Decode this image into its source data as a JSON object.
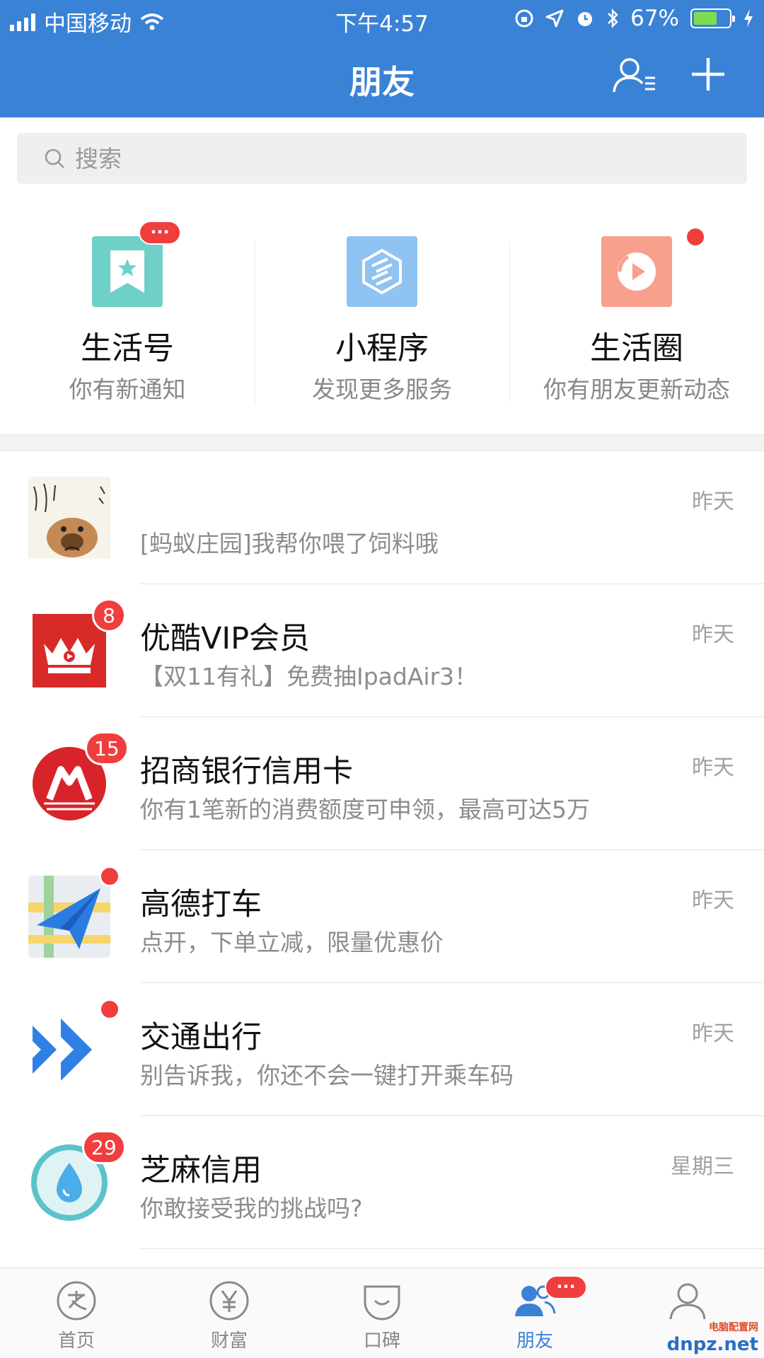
{
  "status_bar": {
    "carrier": "中国移动",
    "time": "下午4:57",
    "battery": "67%",
    "battery_level": 0.67
  },
  "header": {
    "title": "朋友"
  },
  "search": {
    "placeholder": "搜索"
  },
  "services": [
    {
      "title": "生活号",
      "subtitle": "你有新通知",
      "badge": "···",
      "color": "#6fd0c7"
    },
    {
      "title": "小程序",
      "subtitle": "发现更多服务",
      "color": "#8fc3f2"
    },
    {
      "title": "生活圈",
      "subtitle": "你有朋友更新动态",
      "color": "#f7a08e"
    }
  ],
  "messages": [
    {
      "name": "",
      "message": "[蚂蚁庄园]我帮你喂了饲料哦",
      "time": "昨天"
    },
    {
      "name": "优酷VIP会员",
      "message": "【双11有礼】免费抽IpadAir3！",
      "time": "昨天",
      "badge": "8"
    },
    {
      "name": "招商银行信用卡",
      "message": "你有1笔新的消费额度可申领，最高可达5万",
      "time": "昨天",
      "badge": "15"
    },
    {
      "name": "高德打车",
      "message": "点开，下单立减，限量优惠价",
      "time": "昨天"
    },
    {
      "name": "交通出行",
      "message": "别告诉我，你还不会一键打开乘车码",
      "time": "昨天"
    },
    {
      "name": "芝麻信用",
      "message": "你敢接受我的挑战吗?",
      "time": "星期三",
      "badge": "29"
    }
  ],
  "tabbar": [
    {
      "label": "首页"
    },
    {
      "label": "财富"
    },
    {
      "label": "口碑"
    },
    {
      "label": "朋友",
      "badge": "···"
    },
    {
      "label": ""
    }
  ],
  "watermark": {
    "text": "dnpz.net",
    "sub": "电脑配置网"
  },
  "colors": {
    "brand": "#3a82d6",
    "badge": "#f03e3e"
  }
}
